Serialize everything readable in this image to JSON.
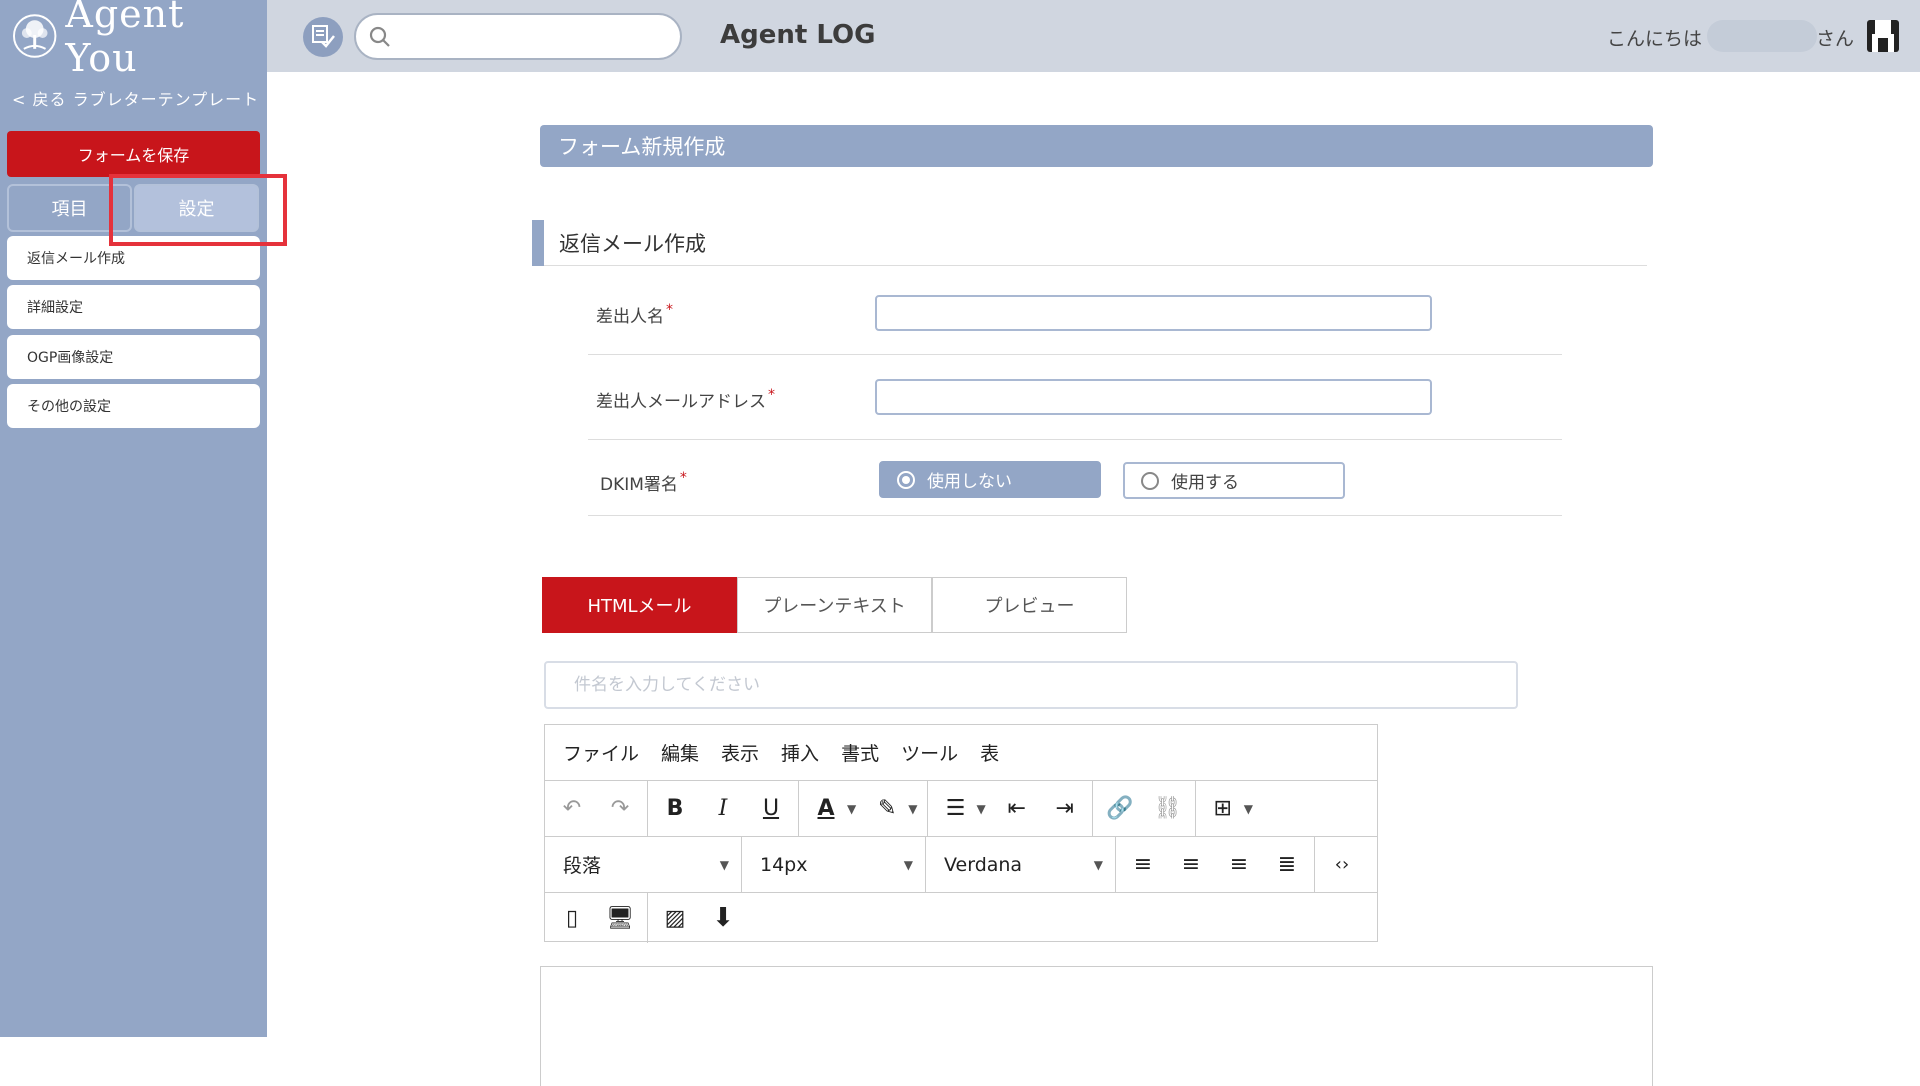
{
  "sidebar": {
    "brand": "Agent You",
    "back_link": "< 戻る ラブレターテンプレート",
    "save_button": "フォームを保存",
    "tabs": {
      "items": "項目",
      "settings": "設定"
    },
    "menu": [
      {
        "label": "返信メール作成"
      },
      {
        "label": "詳細設定"
      },
      {
        "label": "OGP画像設定"
      },
      {
        "label": "その他の設定"
      }
    ]
  },
  "topbar": {
    "app_title": "Agent LOG",
    "search_value": "",
    "greeting": "こんにちは",
    "honorific": "さん"
  },
  "main": {
    "section_title": "フォーム新規作成",
    "subheading": "返信メール作成",
    "fields": {
      "sender_name_label": "差出人名",
      "sender_email_label": "差出人メールアドレス",
      "dkim_label": "DKIM署名",
      "required_mark": "*"
    },
    "dkim_options": {
      "off": "使用しない",
      "on": "使用する",
      "selected": "off"
    },
    "editor_tabs": {
      "html": "HTMLメール",
      "plain": "プレーンテキスト",
      "preview": "プレビュー"
    },
    "subject_placeholder": "件名を入力してください",
    "editor": {
      "menu": [
        "ファイル",
        "編集",
        "表示",
        "挿入",
        "書式",
        "ツール",
        "表"
      ],
      "block_format": "段落",
      "font_size": "14px",
      "font_family": "Verdana"
    }
  },
  "colors": {
    "accent_red": "#c8151b",
    "sidebar_blue": "#93a6c6",
    "highlight_red": "#e5323b"
  }
}
